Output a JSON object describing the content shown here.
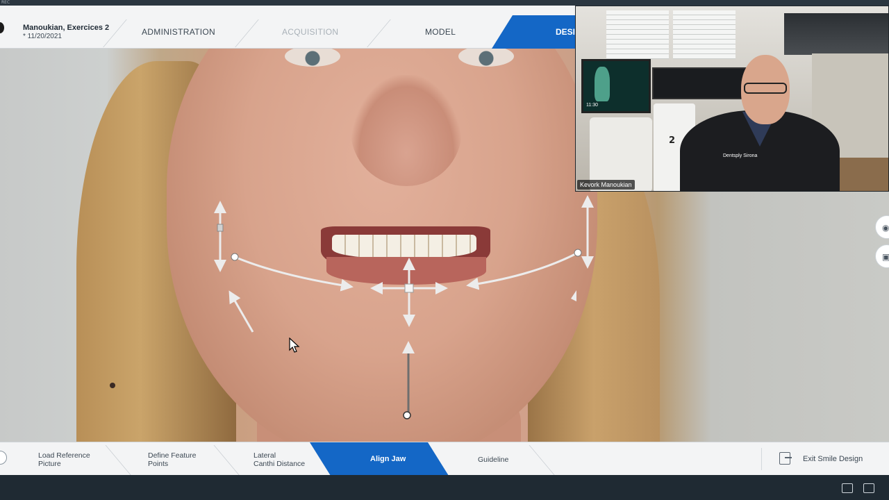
{
  "os": {
    "strip_label": "REC"
  },
  "header": {
    "patient_name": "Manoukian, Exercices 2",
    "patient_date": "* 11/20/2021",
    "nav": [
      {
        "label": "ADMINISTRATION",
        "state": "normal"
      },
      {
        "label": "ACQUISITION",
        "state": "disabled"
      },
      {
        "label": "MODEL",
        "state": "normal"
      },
      {
        "label": "DESI",
        "state": "active"
      }
    ]
  },
  "video": {
    "participant_name": "Kevork Manoukian",
    "monitor_time": "11:30",
    "machine_label": "2",
    "brand_text": "Dentsply Sirona"
  },
  "steps": [
    {
      "label_line1": "Load Reference",
      "label_line2": "Picture",
      "state": "normal"
    },
    {
      "label_line1": "Define Feature",
      "label_line2": "Points",
      "state": "normal"
    },
    {
      "label_line1": "Lateral",
      "label_line2": "Canthi Distance",
      "state": "normal"
    },
    {
      "label_line1": "Align Jaw",
      "label_line2": "",
      "state": "active"
    },
    {
      "label_line1": "Guideline",
      "label_line2": "",
      "state": "normal"
    }
  ],
  "exit": {
    "label": "Exit Smile Design"
  },
  "colors": {
    "accent": "#1467c6",
    "bar_bg": "#f3f4f5",
    "taskbar": "#1f2a33"
  },
  "icons": {
    "side_top": "eye-icon",
    "side_bottom": "image-icon",
    "exit": "exit-icon",
    "taskbar": [
      "chat-icon",
      "share-screen-icon"
    ]
  }
}
